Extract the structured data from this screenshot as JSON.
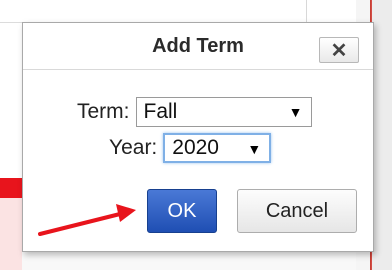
{
  "dialog": {
    "title": "Add Term",
    "close_symbol": "✕"
  },
  "form": {
    "term_label": "Term:",
    "term_value": "Fall",
    "year_label": "Year:",
    "year_value": "2020",
    "dropdown_arrow": "▼"
  },
  "buttons": {
    "ok_label": "OK",
    "cancel_label": "Cancel"
  },
  "annotation": {
    "icon": "red-arrow-icon",
    "color": "#e8141c"
  }
}
